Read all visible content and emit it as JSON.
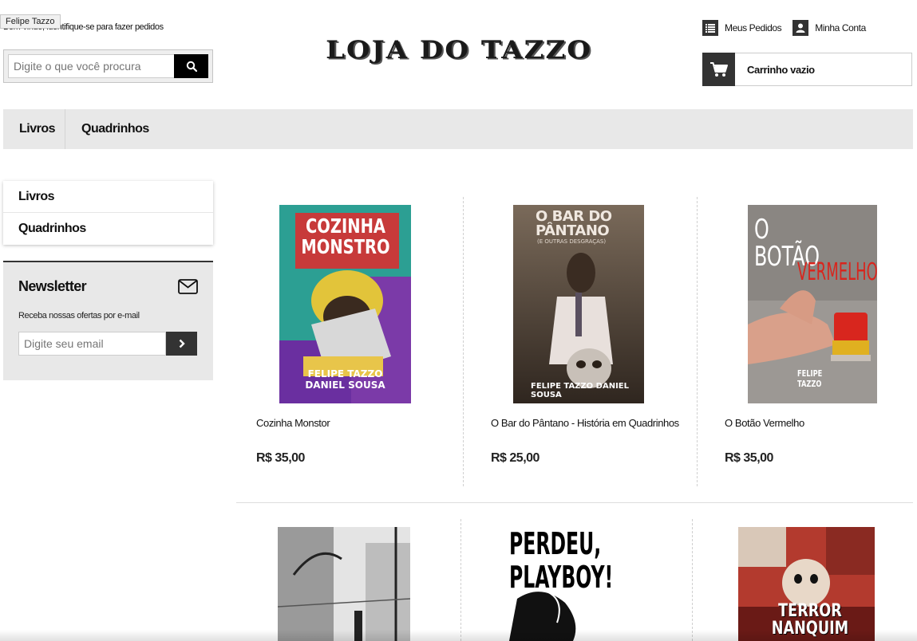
{
  "tooltip": "Felipe Tazzo",
  "header": {
    "welcome": "Bem-vindo, identifique-se para fazer pedidos",
    "search_placeholder": "Digite o que você procura",
    "logo": "LOJA DO TAZZO",
    "my_orders": "Meus Pedidos",
    "my_account": "Minha Conta",
    "cart_label": "Carrinho vazio"
  },
  "nav": {
    "items": [
      {
        "label": "Livros"
      },
      {
        "label": "Quadrinhos"
      }
    ]
  },
  "sidebar": {
    "categories": [
      {
        "label": "Livros"
      },
      {
        "label": "Quadrinhos"
      }
    ],
    "newsletter": {
      "title": "Newsletter",
      "description": "Receba nossas ofertas por e-mail",
      "email_placeholder": "Digite seu email"
    }
  },
  "products": [
    {
      "name": "Cozinha Monstor",
      "price": "R$ 35,00",
      "cover_title": "COZINHA MONSTRO",
      "cover_authors": "FELIPE TAZZO\nDANIEL SOUSA"
    },
    {
      "name": "O Bar do Pântano - História em Quadrinhos",
      "price": "R$ 25,00",
      "cover_title": "O BAR DO PÂNTANO",
      "cover_sub": "(E OUTRAS DESGRAÇAS)",
      "cover_authors": "FELIPE TAZZO DANIEL SOUSA"
    },
    {
      "name": "O Botão Vermelho",
      "price": "R$ 35,00",
      "cover_title": "O BOTÃO",
      "cover_title2": "VERMELHO",
      "cover_authors": "FELIPE TAZZO"
    },
    {
      "name": "",
      "price": ""
    },
    {
      "name": "",
      "price": "",
      "cover_title": "PERDEU, PLAYBOY!"
    },
    {
      "name": "",
      "price": "",
      "cover_title": "TERROR NANQUIM"
    }
  ],
  "colors": {
    "navbar_bg": "#e8e8e8",
    "dark_button": "#333333",
    "search_button": "#000000"
  }
}
